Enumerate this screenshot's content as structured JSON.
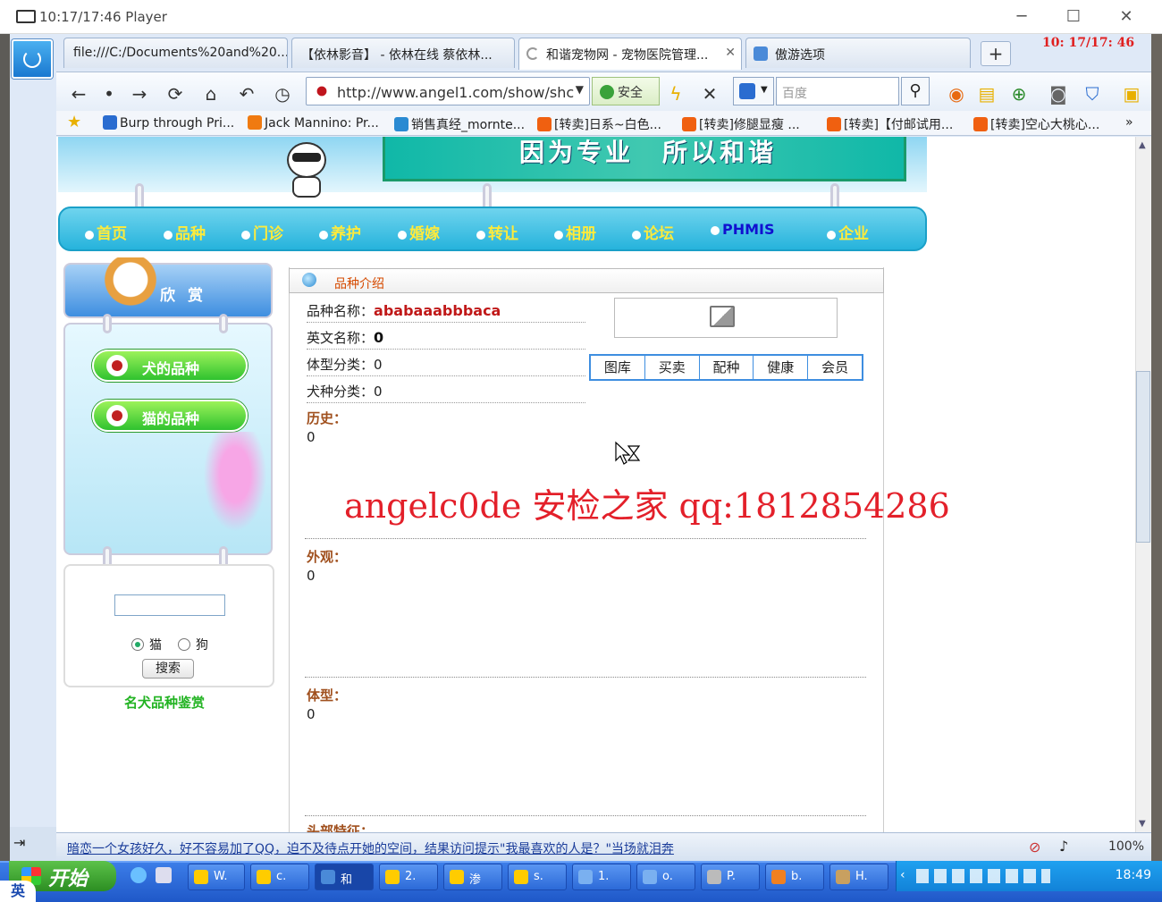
{
  "player": {
    "title": "10:17/17:46 Player"
  },
  "overlay_clock": "10: 17/17: 46",
  "tabs": [
    {
      "label": "file:///C:/Documents%20and%20..."
    },
    {
      "label": "【依林影音】 - 依林在线 蔡依林..."
    },
    {
      "label": "和谐宠物网 - 宠物医院管理..."
    },
    {
      "label": "傲游选项"
    }
  ],
  "address": {
    "url": "http://www.angel1.com/show/shc",
    "safe_label": "安全"
  },
  "search": {
    "placeholder": "百度"
  },
  "bookmarks": [
    {
      "label": "Burp through Pri...",
      "color": "#2a6cd0"
    },
    {
      "label": "Jack Mannino: Pr...",
      "color": "#f07a10"
    },
    {
      "label": "销售真经_mornte...",
      "color": "#2a8ad2"
    },
    {
      "label": "[转卖]日系~白色...",
      "color": "#f06010"
    },
    {
      "label": "[转卖]修腿显瘦 ...",
      "color": "#f06010"
    },
    {
      "label": "[转卖]【付邮试用...",
      "color": "#f06010"
    },
    {
      "label": "[转卖]空心大桃心...",
      "color": "#f06010"
    }
  ],
  "site": {
    "slogan": "因为专业　所以和谐",
    "menu": [
      "首页",
      "品种",
      "门诊",
      "养护",
      "婚嫁",
      "转让",
      "相册",
      "论坛",
      "PHMIS",
      "企业"
    ],
    "sidebar": {
      "title": "欣赏",
      "dog_breeds": "犬的品种",
      "cat_breeds": "猫的品种",
      "radio_cat": "猫",
      "radio_dog": "狗",
      "search_btn": "搜索",
      "famous": "名犬品种鉴赏"
    },
    "content": {
      "tab_label": "品种介绍",
      "name_label": "品种名称：",
      "name_value": "ababaaabbbaca",
      "en_label": "英文名称：",
      "en_value": "0",
      "size_label": "体型分类：",
      "size_value": "0",
      "type_label": "犬种分类：",
      "type_value": "0",
      "history_label": "历史：",
      "history_value": "0",
      "look_label": "外观：",
      "look_value": "0",
      "body_label": "体型：",
      "body_value": "0",
      "head_label": "头部特征："
    },
    "subtabs": [
      "图库",
      "买卖",
      "配种",
      "健康",
      "会员"
    ]
  },
  "watermark": "angelc0de 安检之家 qq:1812854286",
  "statusbar": {
    "news": "暗恋一个女孩好久，好不容易加了QQ，迫不及待点开她的空间，结果访问提示\"我最喜欢的人是？\"当场就泪奔",
    "zoom": "100%"
  },
  "taskbar": {
    "start": "开始",
    "tasks": [
      "W.",
      "c.",
      "和",
      "2.",
      "渗",
      "s.",
      "1.",
      "o.",
      "P.",
      "b.",
      "H."
    ],
    "time": "18:49",
    "ime": "英"
  }
}
